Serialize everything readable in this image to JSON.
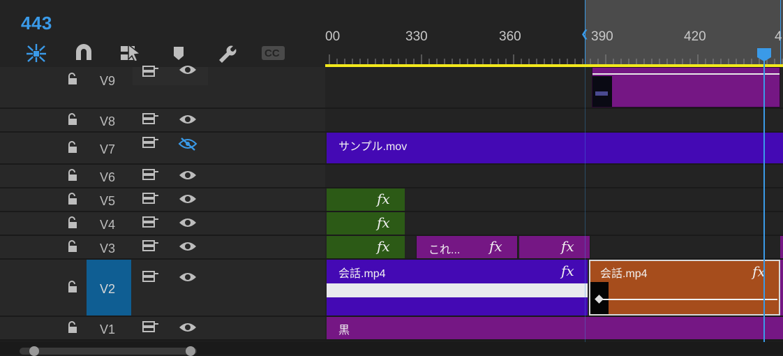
{
  "timecode": "443",
  "toolbar": {
    "tools": [
      "insert-overwrite-sequences-icon",
      "snap-magnet-icon",
      "linked-selection-icon",
      "add-marker-icon",
      "wrench-settings-icon",
      "captions-cc-icon"
    ],
    "cc_label": "CC"
  },
  "ruler": {
    "labels": [
      "00",
      "330",
      "360",
      "390",
      "420",
      "4"
    ]
  },
  "tracks": [
    {
      "name": "V9"
    },
    {
      "name": "V8"
    },
    {
      "name": "V7"
    },
    {
      "name": "V6"
    },
    {
      "name": "V5"
    },
    {
      "name": "V4"
    },
    {
      "name": "V3"
    },
    {
      "name": "V2"
    },
    {
      "name": "V1"
    }
  ],
  "clips": {
    "v7_name": "サンプル.mov",
    "v3_name": "これ...",
    "v2_left_name": "会話.mp4",
    "v2_right_name": "会話.mp4",
    "v1_name": "黒",
    "fx_label": "fx"
  },
  "colors": {
    "accent": "#3a9ae8",
    "purple": "#751784",
    "blue_violet": "#4409b4",
    "green": "#2c5a16",
    "orange": "#a64d1c",
    "yellow": "#f2e81c"
  }
}
